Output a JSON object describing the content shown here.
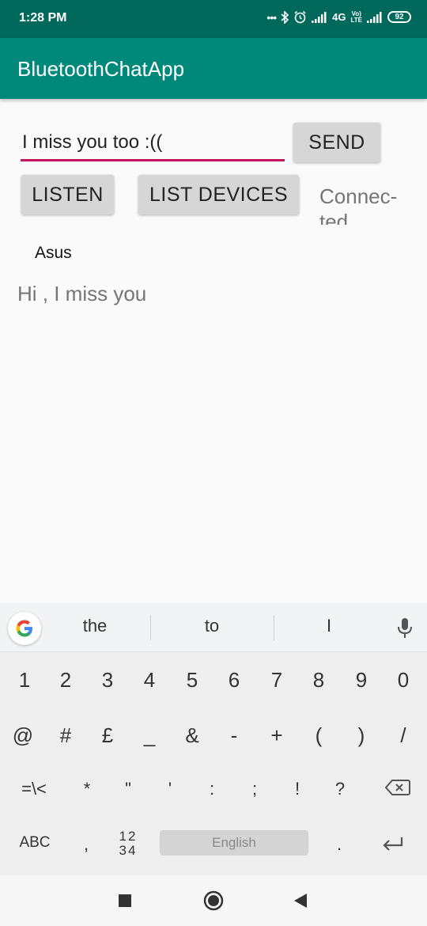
{
  "status_bar": {
    "time": "1:28 PM",
    "dots": "•••",
    "network": "4G",
    "volte_top": "Vo)",
    "volte_bottom": "LTE",
    "battery": "92"
  },
  "app": {
    "title": "BluetoothChatApp"
  },
  "composer": {
    "message_value": "I miss you too :((",
    "send_label": "SEND"
  },
  "controls": {
    "listen_label": "LISTEN",
    "list_devices_label": "LIST DEVICES",
    "status_text": "Connec-ted"
  },
  "devices": [
    {
      "name": "Asus"
    }
  ],
  "received_message": "Hi , I miss you",
  "keyboard": {
    "suggestions": [
      "the",
      "to",
      "I"
    ],
    "row1": [
      "1",
      "2",
      "3",
      "4",
      "5",
      "6",
      "7",
      "8",
      "9",
      "0"
    ],
    "row2": [
      "@",
      "#",
      "£",
      "_",
      "&",
      "-",
      "+",
      "(",
      ")",
      "/"
    ],
    "row3": [
      "=\\<",
      "*",
      "\"",
      "'",
      ":",
      ";",
      "!",
      "?"
    ],
    "abc_label": "ABC",
    "comma": ",",
    "numeric_top": "12",
    "numeric_bottom": "34",
    "space_label": "English",
    "period": "."
  },
  "icons": {
    "google": "google-g-icon",
    "mic": "mic-icon",
    "backspace": "backspace-icon",
    "enter": "enter-icon",
    "bluetooth": "bluetooth-icon",
    "alarm": "alarm-icon",
    "signal": "signal-icon",
    "nav_recents": "square-icon",
    "nav_home": "circle-icon",
    "nav_back": "triangle-back-icon"
  },
  "colors": {
    "status_bar": "#00695c",
    "app_bar": "#00897b",
    "input_underline": "#c2185b",
    "button": "#d6d6d6"
  }
}
